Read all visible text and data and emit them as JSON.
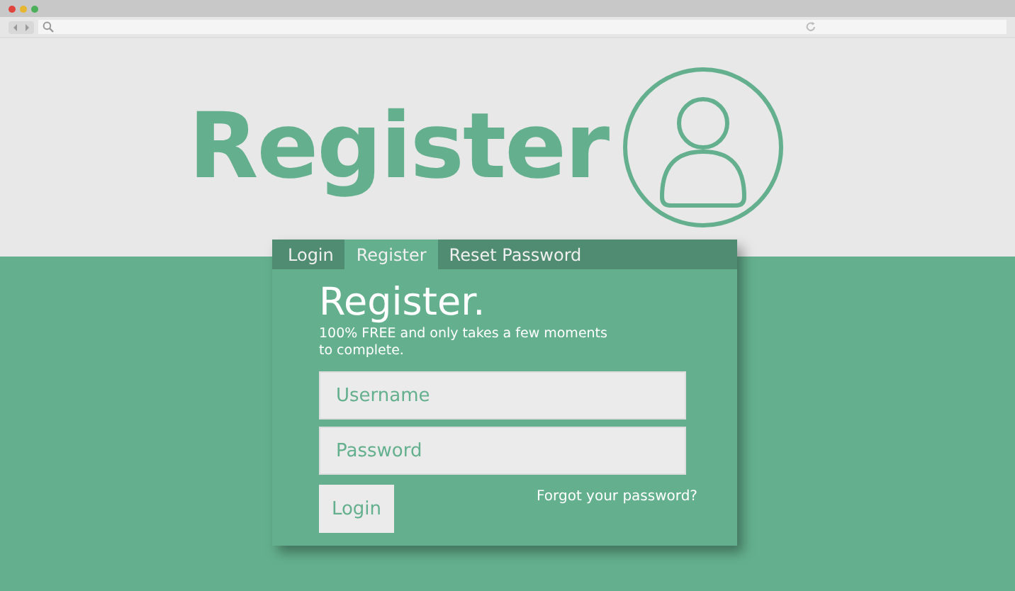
{
  "hero": {
    "title": "Register"
  },
  "tabs": [
    {
      "label": "Login",
      "selected": false
    },
    {
      "label": "Register",
      "selected": true
    },
    {
      "label": "Reset Password",
      "selected": false
    }
  ],
  "form": {
    "heading": "Register.",
    "subtitle": "100% FREE and only takes a few moments to complete.",
    "fields": [
      {
        "placeholder": "Username"
      },
      {
        "placeholder": "Password"
      }
    ],
    "button": "Login",
    "link": "Forgot your password?"
  }
}
